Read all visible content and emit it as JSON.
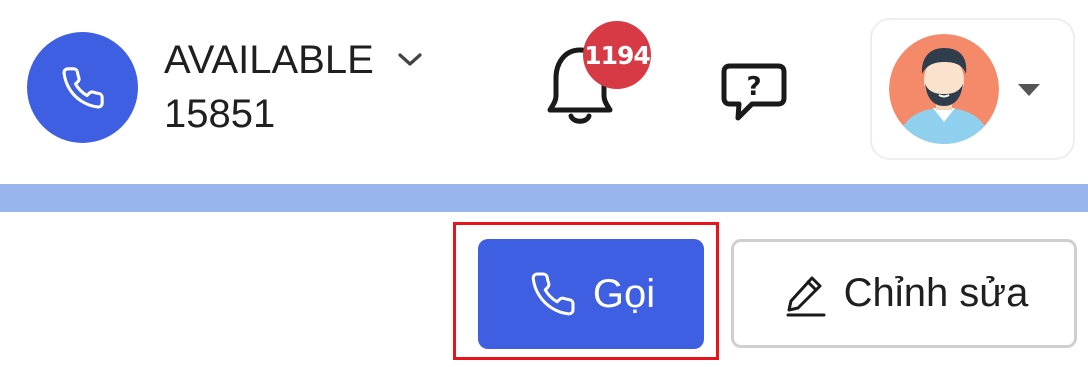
{
  "header": {
    "phone_status": {
      "icon": "phone-icon",
      "status_label": "AVAILABLE",
      "extension": "15851",
      "dropdown_icon": "chevron-down-icon"
    },
    "notifications": {
      "icon": "bell-icon",
      "badge_count": "1194"
    },
    "help": {
      "icon": "help-question-icon"
    },
    "profile": {
      "avatar_icon": "user-avatar",
      "dropdown_icon": "caret-down-icon"
    }
  },
  "actions": {
    "call_button": {
      "icon": "phone-icon",
      "label": "Gọi"
    },
    "edit_button": {
      "icon": "pencil-icon",
      "label": "Chỉnh sửa"
    }
  },
  "colors": {
    "primary_blue": "#3f5fe3",
    "band_blue": "#99b5ed",
    "badge_red": "#d83a45",
    "highlight_red": "#e8141c",
    "avatar_bg": "#f58a6a"
  }
}
